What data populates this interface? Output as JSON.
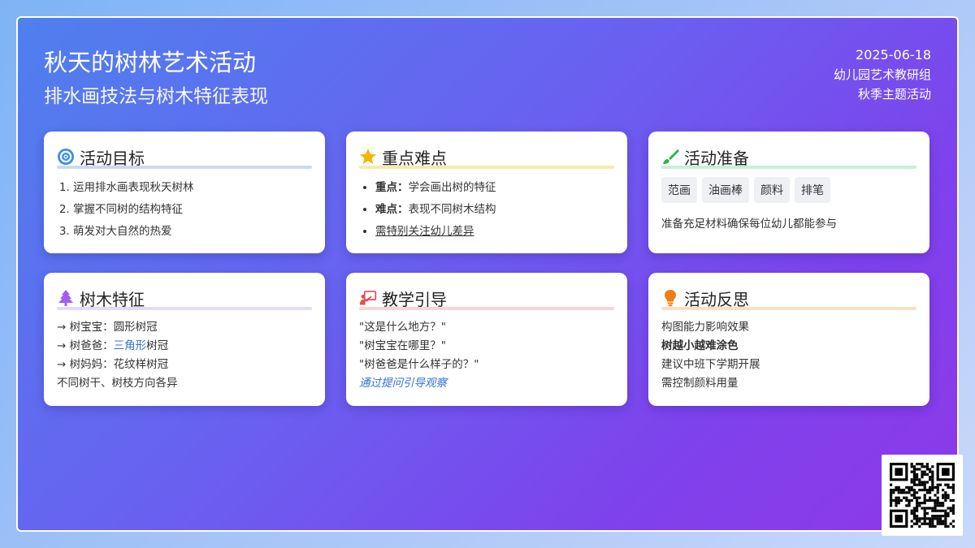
{
  "header": {
    "title": "秋天的树林艺术活动",
    "subtitle": "排水画技法与树木特征表现",
    "date": "2025-06-18",
    "org": "幼儿园艺术教研组",
    "theme": "秋季主题活动"
  },
  "colors": {
    "goal_bar": "#c9dbf2",
    "key_bar": "#f7eaa8",
    "prep_bar": "#c8efd3",
    "tree_bar": "#e3dbf7",
    "guide_bar": "#f5d5d8",
    "reflect_bar": "#f8e0c5",
    "highlight_blue": "#2f6fd6"
  },
  "cards": {
    "goals": {
      "icon": "target-icon",
      "title": "活动目标",
      "items": [
        "运用排水画表现秋天树林",
        "掌握不同树的结构特征",
        "萌发对大自然的热爱"
      ]
    },
    "key": {
      "icon": "star-icon",
      "title": "重点难点",
      "focus_label": "重点：",
      "focus_text": "学会画出树的特征",
      "difficulty_label": "难点：",
      "difficulty_text": "表现不同树木结构",
      "note": "需特别关注幼儿差异"
    },
    "prep": {
      "icon": "paintbrush-icon",
      "title": "活动准备",
      "tags": [
        "范画",
        "油画棒",
        "颜料",
        "排笔"
      ],
      "note": "准备充足材料确保每位幼儿都能参与"
    },
    "trees": {
      "icon": "tree-icon",
      "title": "树木特征",
      "line1": "→ 树宝宝：圆形树冠",
      "line2_prefix": "→ 树爸爸：",
      "line2_highlight": "三角形",
      "line2_suffix": "树冠",
      "line3": "→ 树妈妈：花纹样树冠",
      "line4": "不同树干、树枝方向各异"
    },
    "guide": {
      "icon": "teacher-board-icon",
      "title": "教学引导",
      "q1": "\"这是什么地方？\"",
      "q2": "\"树宝宝在哪里？\"",
      "q3": "\"树爸爸是什么样子的？\"",
      "note": "通过提问引导观察"
    },
    "reflect": {
      "icon": "lightbulb-icon",
      "title": "活动反思",
      "line1": "构图能力影响效果",
      "line2": "树越小越难涂色",
      "line3": "建议中班下学期开展",
      "line4": "需控制颜料用量"
    }
  }
}
